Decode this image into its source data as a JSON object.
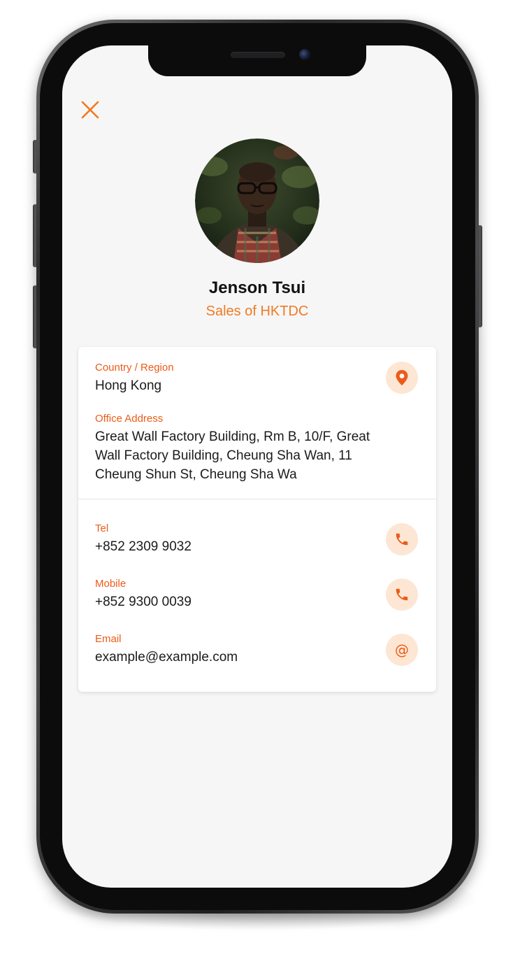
{
  "profile": {
    "name": "Jenson Tsui",
    "role": "Sales of HKTDC"
  },
  "details": {
    "country_label": "Country / Region",
    "country_value": "Hong Kong",
    "address_label": "Office Address",
    "address_value": "Great Wall Factory Building, Rm B, 10/F, Great Wall Factory Building, Cheung Sha Wan, 11 Cheung Shun St, Cheung Sha Wa",
    "tel_label": "Tel",
    "tel_value": "+852 2309 9032",
    "mobile_label": "Mobile",
    "mobile_value": "+852 9300 0039",
    "email_label": "Email",
    "email_value": "example@example.com",
    "email_glyph": "@"
  },
  "icons": {
    "close": "close-icon",
    "location": "map-pin-icon",
    "tel": "phone-icon",
    "mobile": "phone-icon",
    "email": "at-sign-icon"
  },
  "colors": {
    "accent": "#ec5b18",
    "accent_light": "#f07a23",
    "icon_bg": "#fde6d3",
    "screen_bg": "#f6f6f6",
    "card_bg": "#ffffff"
  }
}
